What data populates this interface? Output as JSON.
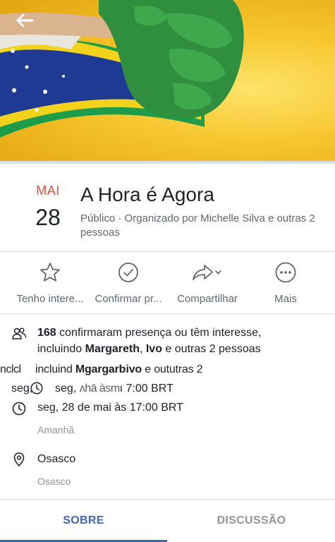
{
  "event": {
    "month": "MAI",
    "day": "28",
    "title": "A Hora é Agora",
    "subtitle": "Público · Organizado por Michelle Silva e outras 2 pessoas"
  },
  "actions": [
    {
      "label": "Tenho intere...",
      "icon": "star-icon"
    },
    {
      "label": "Confirmar pr...",
      "icon": "check-circle-icon"
    },
    {
      "label": "Compartilhar",
      "icon": "share-icon"
    },
    {
      "label": "Mais",
      "icon": "more-icon"
    }
  ],
  "attendance": {
    "count": "168",
    "line1_rest": " confirmaram presença ou têm interesse,",
    "line2_prefix": "incluindo ",
    "name1": "Margareth",
    "sep": ", ",
    "name2": "Ivo",
    "line2_suffix": " e outras 2 pessoas"
  },
  "glitch": {
    "line1_left": "nclcl",
    "line1_main": "incluind",
    "line1_name": "Mgargarb",
    "line1_name2": "ivo",
    "line1_tail": " e oututras 2",
    "line2_left": "seg,",
    "line2_main": "seg, ",
    "line2_blur": "ʌhā àsm",
    "line2_time": "ı 7:00 BRT"
  },
  "schedule": {
    "datetime": "seg, 28 de mai às 17:00 BRT",
    "relative": "Amanhã"
  },
  "location": {
    "name": "Osasco",
    "detail": "Osasco"
  },
  "tabs": [
    {
      "label": "SOBRE",
      "active": true
    },
    {
      "label": "DISCUSSÃO",
      "active": false
    }
  ],
  "colors": {
    "accent": "#4267b2",
    "month": "#e14c3d",
    "text": "#1d2129",
    "muted": "#606770"
  }
}
